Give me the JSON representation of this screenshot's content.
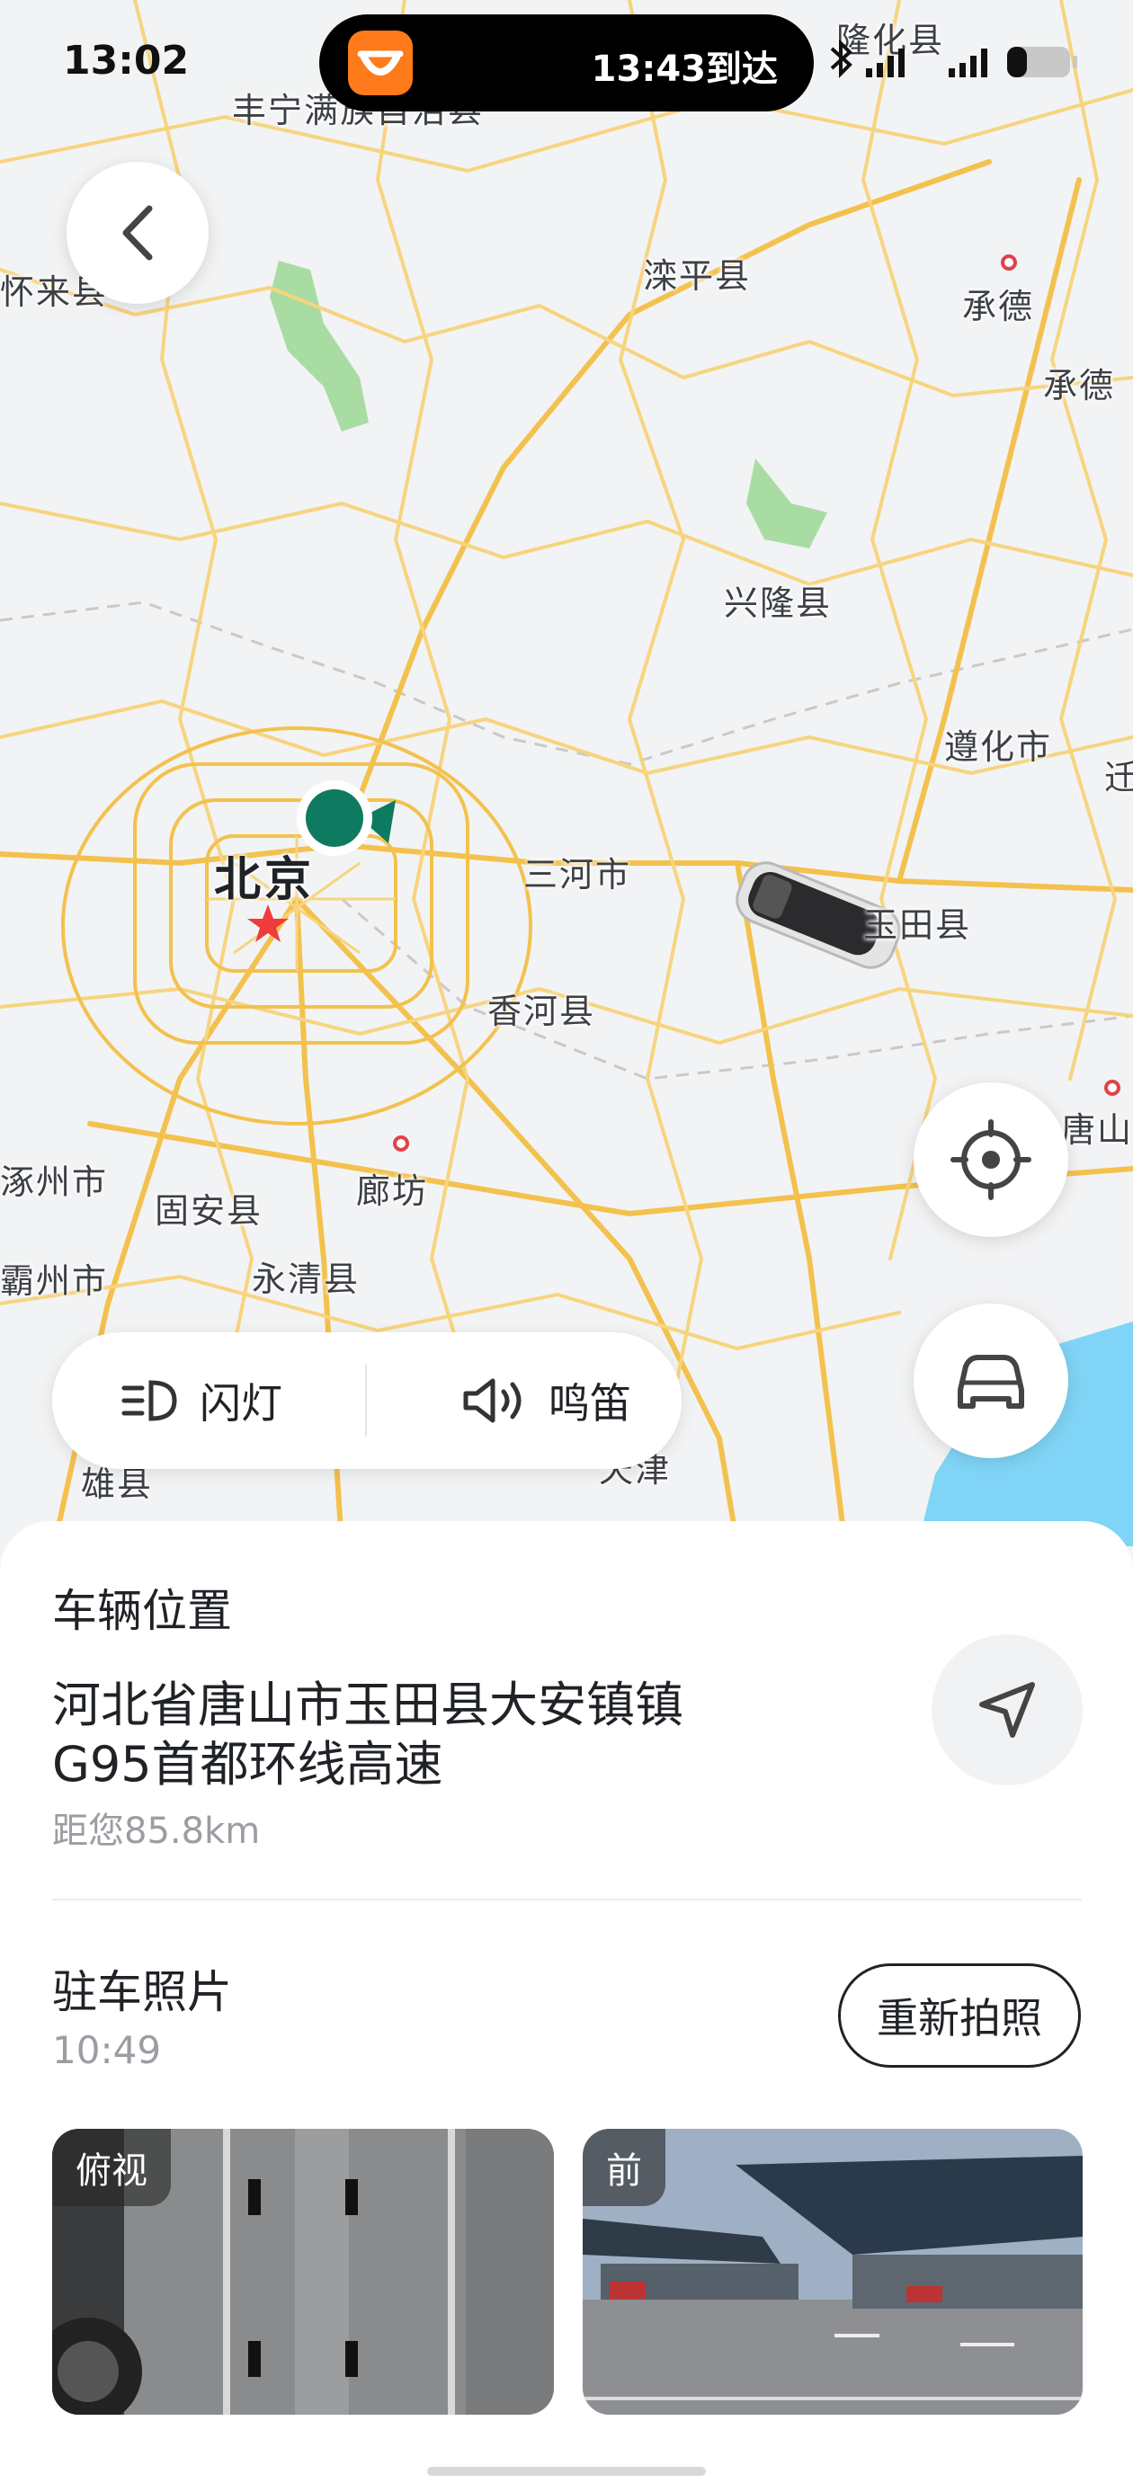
{
  "status_bar": {
    "time": "13:02",
    "eta": "13:43到达"
  },
  "map": {
    "cities": [
      "丰宁满族自治县",
      "隆化县",
      "承德",
      "承德",
      "滦平县",
      "兴隆县",
      "遵化市",
      "北京",
      "三河市",
      "玉田县",
      "香河县",
      "涿州市",
      "固安县",
      "廊坊",
      "永清县",
      "霸州市",
      "雄县",
      "天津",
      "唐山",
      "怀来县",
      "迁"
    ]
  },
  "actions": {
    "flash_label": "闪灯",
    "horn_label": "鸣笛"
  },
  "vehicle_location": {
    "title": "车辆位置",
    "address_line1": "河北省唐山市玉田县大安镇镇",
    "address_line2": "G95首都环线高速",
    "distance": "距您85.8km"
  },
  "parking_photos": {
    "title": "驻车照片",
    "time": "10:49",
    "retake_label": "重新拍照",
    "photos": [
      {
        "tag": "俯视"
      },
      {
        "tag": "前"
      }
    ]
  },
  "colors": {
    "road": "#f6c85f",
    "water": "#7fd3f5",
    "park": "#9fdc9f",
    "marker": "#0e7a5f"
  }
}
